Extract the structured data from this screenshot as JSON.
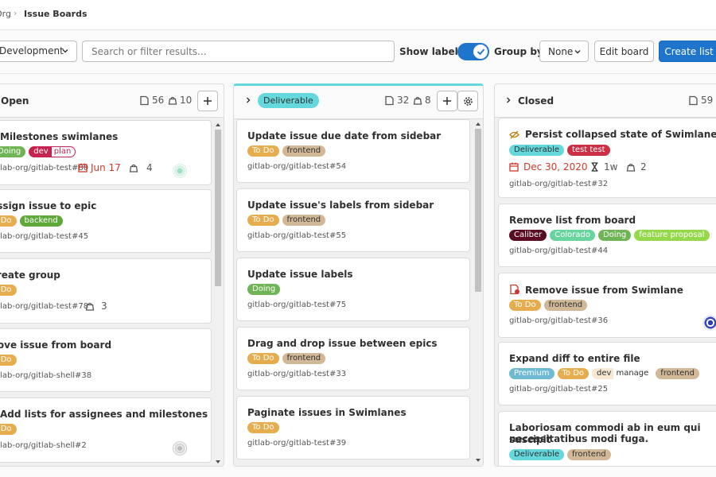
{
  "breadcrumb": {
    "org": "Org",
    "separator": "›",
    "current": "Issue Boards"
  },
  "toolbar": {
    "board_selector": "Development",
    "search_placeholder": "Search or filter results...",
    "show_labels_label": "Show labels",
    "show_labels_on": true,
    "group_by_label": "Group by",
    "group_by_value": "None",
    "edit_board_label": "Edit board",
    "create_list_label": "Create list"
  },
  "lists": [
    {
      "title": "Open",
      "issue_count": "56",
      "weight": "10",
      "cards": [
        {
          "title": "Milestones swimlanes",
          "labels": [
            "Doing",
            "dev",
            "plan"
          ],
          "ref_project": "gitlab-org/gitlab-test",
          "ref_id": "#80",
          "due": "Jun 17",
          "weight": "4"
        },
        {
          "title": "Assign issue to epic",
          "labels": [
            "To Do",
            "backend"
          ],
          "ref_project": "gitlab-org/gitlab-test",
          "ref_id": "#45"
        },
        {
          "title": "Create group",
          "labels": [
            "To Do"
          ],
          "ref_project": "gitlab-org/gitlab-test",
          "ref_id": "#78",
          "weight": "3"
        },
        {
          "title": "Remove issue from board",
          "labels": [
            "To Do"
          ],
          "ref_project": "gitlab-org/gitlab-shell",
          "ref_id": "#38"
        },
        {
          "title": "Add lists for assignees and milestones",
          "labels": [
            "To Do"
          ],
          "ref_project": "gitlab-org/gitlab-shell",
          "ref_id": "#2"
        }
      ]
    },
    {
      "title": "Deliverable",
      "issue_count": "32",
      "weight": "8",
      "cards": [
        {
          "title": "Update issue due date from sidebar",
          "labels": [
            "To Do",
            "frontend"
          ],
          "ref_project": "gitlab-org/gitlab-test",
          "ref_id": "#54"
        },
        {
          "title": "Update issue's labels from sidebar",
          "labels": [
            "To Do",
            "frontend"
          ],
          "ref_project": "gitlab-org/gitlab-test",
          "ref_id": "#55"
        },
        {
          "title": "Update issue labels",
          "labels": [
            "Doing"
          ],
          "ref_project": "gitlab-org/gitlab-test",
          "ref_id": "#75"
        },
        {
          "title": "Drag and drop issue between epics",
          "labels": [
            "To Do",
            "frontend"
          ],
          "ref_project": "gitlab-org/gitlab-test",
          "ref_id": "#33"
        },
        {
          "title": "Paginate issues in Swimlanes",
          "labels": [
            "To Do"
          ],
          "ref_project": "gitlab-org/gitlab-test",
          "ref_id": "#39"
        }
      ]
    },
    {
      "title": "Closed",
      "issue_count": "59",
      "cards": [
        {
          "title": "Persist collapsed state of Swimlanes",
          "labels": [
            "Deliverable",
            "test test"
          ],
          "ref_project": "gitlab-org/gitlab-test",
          "ref_id": "#32",
          "due": "Dec 30, 2020",
          "time": "1w",
          "weight": "2"
        },
        {
          "title": "Remove list from board",
          "labels": [
            "Caliber",
            "Colorado",
            "Doing",
            "feature proposal"
          ],
          "ref_project": "gitlab-org/gitlab-test",
          "ref_id": "#44"
        },
        {
          "title": "Remove issue from Swimlane",
          "labels": [
            "To Do",
            "frontend"
          ],
          "ref_project": "gitlab-org/gitlab-test",
          "ref_id": "#36"
        },
        {
          "title": "Expand diff to entire file",
          "labels": [
            "Premium",
            "To Do",
            "dev",
            "manage",
            "frontend"
          ],
          "ref_project": "gitlab-org/gitlab-test",
          "ref_id": "#25"
        },
        {
          "title_line1": "Laboriosam commodi ab in eum qui suscipit",
          "title_line2": "necessitatibus modi fuga.",
          "labels": [
            "Deliverable",
            "frontend"
          ]
        }
      ]
    }
  ],
  "colors": {
    "primary": "#1f75cb",
    "doing": "#6fb556",
    "todo": "#e6ad4f",
    "frontend": "#d1b897",
    "backend": "#5fa83a",
    "dev": "#c6234e",
    "deliverable": "#64d8dd",
    "test_test": "#cc2e45",
    "caliber": "#5a0a21",
    "colorado": "#68d49d",
    "feature_proposal": "#93d94a",
    "premium": "#6fbad3",
    "due_red": "#cc3a2d"
  }
}
